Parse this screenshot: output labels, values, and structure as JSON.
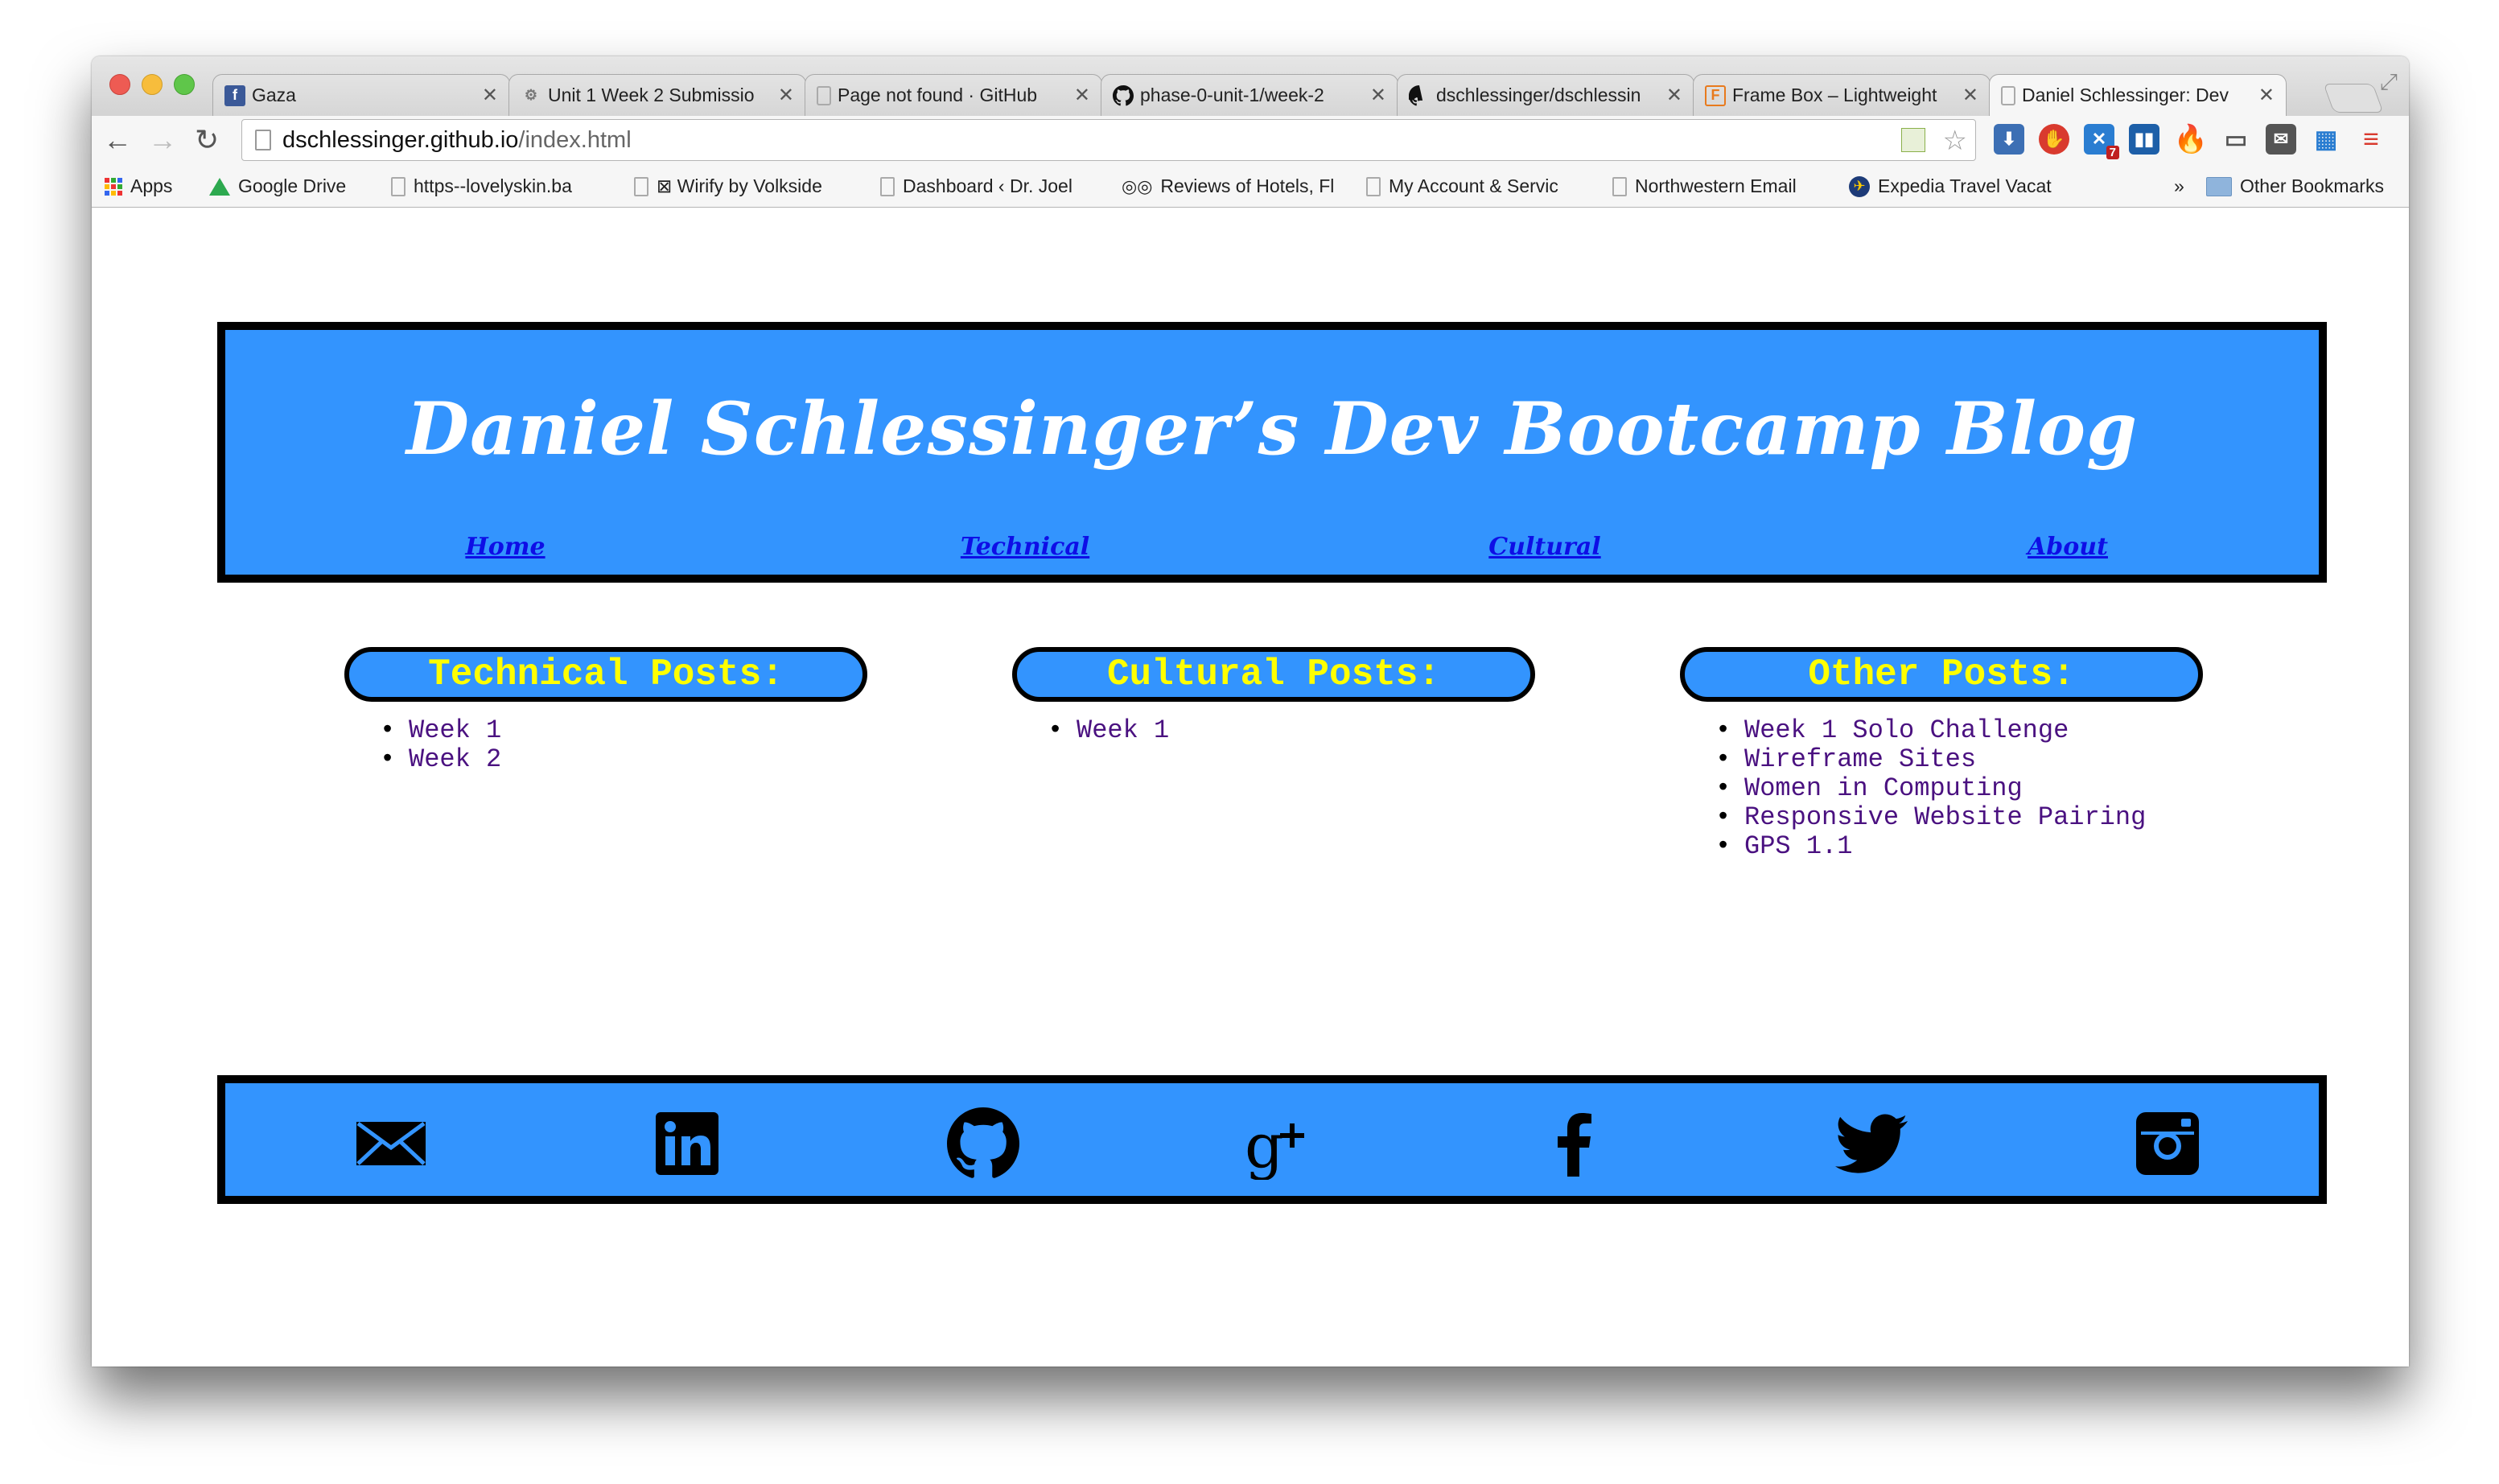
{
  "browser": {
    "tabs": [
      {
        "title": "Gaza",
        "favicon": "facebook-icon",
        "active": false
      },
      {
        "title": "Unit 1 Week 2 Submissio",
        "favicon": "gear-icon",
        "active": false
      },
      {
        "title": "Page not found · GitHub",
        "favicon": "page-icon",
        "active": false
      },
      {
        "title": "phase-0-unit-1/week-2",
        "favicon": "github-icon",
        "active": false
      },
      {
        "title": "dschlessinger/dschlessin",
        "favicon": "github-icon",
        "active": false
      },
      {
        "title": "Frame Box – Lightweight",
        "favicon": "framebox-icon",
        "active": false
      },
      {
        "title": "Daniel Schlessinger: Dev",
        "favicon": "page-icon",
        "active": true
      }
    ],
    "url_host": "dschlessinger.github.io",
    "url_path": "/index.html",
    "bookmarks": [
      {
        "label": "Apps",
        "icon": "apps-grid-icon"
      },
      {
        "label": "Google Drive",
        "icon": "google-drive-icon"
      },
      {
        "label": "https--lovelyskin.ba",
        "icon": "page-icon"
      },
      {
        "label": "⊠ Wirify by Volkside",
        "icon": "page-icon"
      },
      {
        "label": "Dashboard ‹ Dr. Joel",
        "icon": "page-icon"
      },
      {
        "label": "Reviews of Hotels, Fl",
        "icon": "tripadvisor-icon"
      },
      {
        "label": "My Account & Servic",
        "icon": "page-icon"
      },
      {
        "label": "Northwestern Email",
        "icon": "page-icon"
      },
      {
        "label": "Expedia Travel Vacat",
        "icon": "expedia-icon"
      }
    ],
    "bookmarks_overflow": "»",
    "other_bookmarks": "Other Bookmarks",
    "extension_badge": "7"
  },
  "site": {
    "title": "Daniel Schlessinger’s Dev Bootcamp Blog",
    "nav": [
      "Home",
      "Technical",
      "Cultural",
      "About"
    ],
    "columns": [
      {
        "heading": "Technical Posts:",
        "posts": [
          "Week 1",
          "Week 2"
        ]
      },
      {
        "heading": "Cultural Posts:",
        "posts": [
          "Week 1"
        ]
      },
      {
        "heading": "Other Posts:",
        "posts": [
          "Week 1 Solo Challenge",
          "Wireframe Sites",
          "Women in Computing",
          "Responsive Website Pairing",
          "GPS 1.1"
        ]
      }
    ],
    "social": [
      "email-icon",
      "linkedin-icon",
      "github-icon",
      "google-plus-icon",
      "facebook-icon",
      "twitter-icon",
      "instagram-icon"
    ],
    "colors": {
      "brand_blue": "#3394fe",
      "heading_yellow": "#ffff00",
      "nav_link": "#0e0ee6",
      "post_link": "#4a1180"
    }
  }
}
